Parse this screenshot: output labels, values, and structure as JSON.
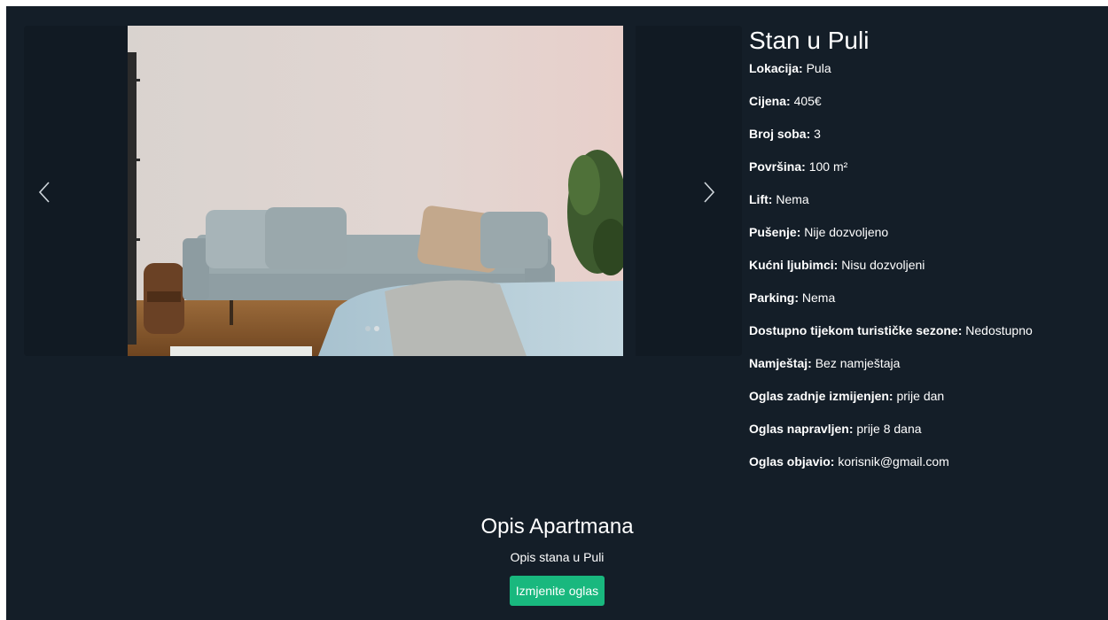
{
  "listing": {
    "title": "Stan u Puli",
    "details": [
      {
        "label": "Lokacija:",
        "value": "Pula"
      },
      {
        "label": "Cijena:",
        "value": "405€"
      },
      {
        "label": "Broj soba:",
        "value": "3"
      },
      {
        "label": "Površina:",
        "value": "100 m²"
      },
      {
        "label": "Lift:",
        "value": "Nema"
      },
      {
        "label": "Pušenje:",
        "value": "Nije dozvoljeno"
      },
      {
        "label": "Kućni ljubimci:",
        "value": "Nisu dozvoljeni"
      },
      {
        "label": "Parking:",
        "value": "Nema"
      },
      {
        "label": "Dostupno tijekom turističke sezone:",
        "value": "Nedostupno"
      },
      {
        "label": "Namještaj:",
        "value": "Bez namještaja"
      },
      {
        "label": "Oglas zadnje izmijenjen:",
        "value": "prije dan"
      },
      {
        "label": "Oglas napravljen:",
        "value": "prije 8 dana"
      },
      {
        "label": "Oglas objavio:",
        "value": "korisnik@gmail.com"
      }
    ]
  },
  "carousel": {
    "prev_icon": "chevron-left-icon",
    "next_icon": "chevron-right-icon",
    "slide_count": 2,
    "active_slide": 2
  },
  "description": {
    "heading": "Opis Apartmana",
    "text": "Opis stana u Puli"
  },
  "actions": {
    "edit_label": "Izmjenite oglas"
  },
  "colors": {
    "background": "#141e28",
    "accent": "#19b87e"
  }
}
